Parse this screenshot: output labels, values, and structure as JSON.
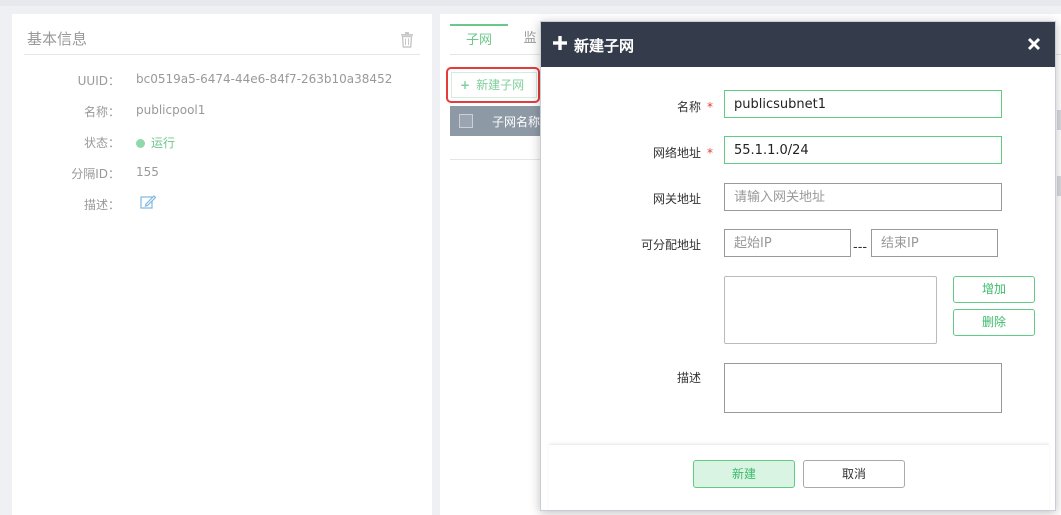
{
  "info": {
    "title": "基本信息",
    "fields": [
      {
        "label": "UUID：",
        "value": "bc0519a5-6474-44e6-84f7-263b10a38452"
      },
      {
        "label": "名称：",
        "value": "publicpool1"
      },
      {
        "label": "状态：",
        "value": "运行"
      },
      {
        "label": "分隔ID：",
        "value": "155"
      },
      {
        "label": "描述：",
        "value": ""
      }
    ]
  },
  "tabs": [
    {
      "label": "子网",
      "active": true
    },
    {
      "label": "监",
      "active": false
    }
  ],
  "toolbar": {
    "new_subnet": "新建子网"
  },
  "table": {
    "columns": [
      "子网名称"
    ]
  },
  "modal": {
    "title": "新建子网",
    "fields": {
      "name": {
        "label": "名称",
        "required": true,
        "value": "publicsubnet1"
      },
      "network": {
        "label": "网络地址",
        "required": true,
        "value": "55.1.1.0/24"
      },
      "gateway": {
        "label": "网关地址",
        "placeholder": "请输入网关地址"
      },
      "allocation": {
        "label": "可分配地址",
        "start_placeholder": "起始IP",
        "separator": "---",
        "end_placeholder": "结束IP"
      },
      "description": {
        "label": "描述"
      }
    },
    "add_label": "增加",
    "delete_label": "删除",
    "submit_label": "新建",
    "cancel_label": "取消"
  },
  "colors": {
    "accent": "#5fcb84",
    "header_bg": "#343c4c",
    "highlight": "#e53b3b"
  }
}
